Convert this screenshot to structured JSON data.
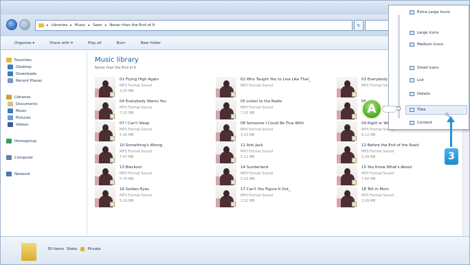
{
  "address": {
    "crumbs": [
      "Libraries",
      "Music",
      "Sean",
      "Never than the End of It"
    ],
    "refresh_glyph": "↻"
  },
  "toolbar": {
    "items": [
      "Organize ▾",
      "Share with ▾",
      "Play all",
      "Burn",
      "New folder"
    ]
  },
  "sidebar": {
    "items": [
      {
        "label": "Favorites",
        "icon": "star-icon",
        "color": "#e8b83a"
      },
      {
        "label": "Desktop",
        "icon": "desktop-icon",
        "color": "#3a7cc7"
      },
      {
        "label": "Downloads",
        "icon": "downloads-icon",
        "color": "#3a7cc7"
      },
      {
        "label": "Recent Places",
        "icon": "recent-places-icon",
        "color": "#7a98c0"
      },
      {
        "label": "Libraries",
        "icon": "libraries-icon",
        "color": "#c9a43a"
      },
      {
        "label": "Documents",
        "icon": "documents-icon",
        "color": "#d7c089"
      },
      {
        "label": "Music",
        "icon": "music-icon",
        "color": "#3a7cc7"
      },
      {
        "label": "Pictures",
        "icon": "pictures-icon",
        "color": "#6a9fd6"
      },
      {
        "label": "Videos",
        "icon": "videos-icon",
        "color": "#3d5e8c"
      },
      {
        "label": "Homegroup",
        "icon": "homegroup-icon",
        "color": "#3a9a5e"
      },
      {
        "label": "Computer",
        "icon": "computer-icon",
        "color": "#5e7fa8"
      },
      {
        "label": "Network",
        "icon": "network-icon",
        "color": "#4a78b8"
      }
    ]
  },
  "main": {
    "title": "Music library",
    "subtitle": "Never than the End of It",
    "tracks": [
      {
        "name": "01 Flying High Again",
        "type": "MP3 Format Sound",
        "size": "3.25 MB"
      },
      {
        "name": "02 Who Taught You to Live Like That_",
        "type": "MP3 Format Sound",
        "size": ""
      },
      {
        "name": "03 Everybody",
        "type": "MP3 Format Sound",
        "size": ""
      },
      {
        "name": "04 Everybody Wants You",
        "type": "MP3 Format Sound",
        "size": "7.20 MB"
      },
      {
        "name": "05 Listen to the Radio",
        "type": "MP3 Format Sound",
        "size": "7.20 MB"
      },
      {
        "name": "06",
        "type": "MP3 Format Sound",
        "size": "5.49 MB"
      },
      {
        "name": "07 I Can't Sleep",
        "type": "MP3 Format Sound",
        "size": "5.95 MB"
      },
      {
        "name": "08 Someone I Could Be True With",
        "type": "MP3 Format Sound",
        "size": "3.33 MB"
      },
      {
        "name": "09 Right or Wrong",
        "type": "MP3 Format Sound",
        "size": "6.12 MB"
      },
      {
        "name": "10 Something's Wrong",
        "type": "MP3 Format Sound",
        "size": "7.47 MB"
      },
      {
        "name": "11 Anti Jack",
        "type": "MP3 Format Sound",
        "size": "5.12 MB"
      },
      {
        "name": "12 Before the End of the Road",
        "type": "MP3 Format Sound",
        "size": "3.29 MB"
      },
      {
        "name": "13 Blackout",
        "type": "MP3 Format Sound",
        "size": "5.70 MB"
      },
      {
        "name": "14 Sunderland",
        "type": "MP3 Format Sound",
        "size": "5.15 MB"
      },
      {
        "name": "15 You Know What's About",
        "type": "MP3 Format Sound",
        "size": "7.60 MB"
      },
      {
        "name": "16 Golden Eyes",
        "type": "MP3 Format Sound",
        "size": "5.20 MB"
      },
      {
        "name": "17 Can't You Figure It Out_",
        "type": "MP3 Format Sound",
        "size": "3.52 MB"
      },
      {
        "name": "18 Tell m Mom",
        "type": "MP3 Format Sound",
        "size": "3.09 MB"
      }
    ]
  },
  "status": {
    "count": "30 items",
    "state_label": "State:",
    "shared": "Private"
  },
  "view_menu": {
    "items": [
      "Extra Large Icons",
      "Large Icons",
      "Medium Icons",
      "Small Icons",
      "List",
      "Details",
      "Tiles",
      "Content"
    ],
    "selected": "Tiles"
  },
  "callouts": {
    "a": "A",
    "three": "3"
  }
}
